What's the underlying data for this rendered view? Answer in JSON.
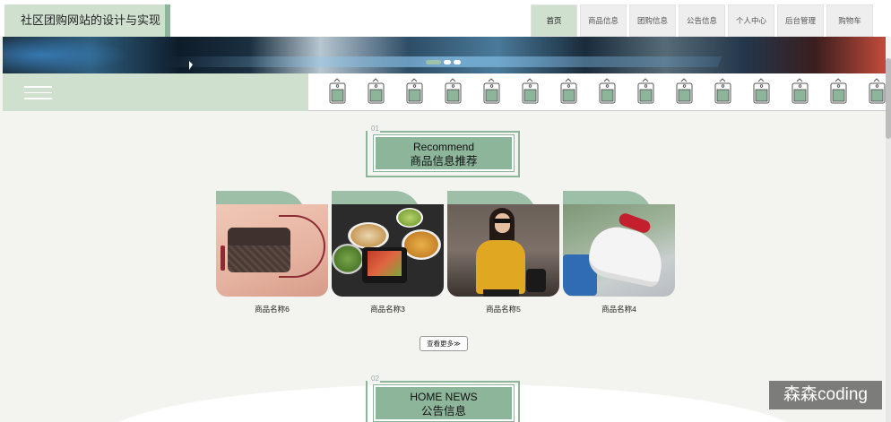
{
  "header": {
    "site_title": "社区团购网站的设计与实现",
    "nav": [
      "首页",
      "商品信息",
      "团购信息",
      "公告信息",
      "个人中心",
      "后台管理",
      "购物车"
    ],
    "active_nav": "首页"
  },
  "banner": {
    "slide_count": 3,
    "active_slide": 1
  },
  "category_strip": {
    "tag_icon": "price-tag-icon",
    "tag_count": 15
  },
  "recommend": {
    "number": "01",
    "title_en": "Recommend",
    "title_cn": "商品信息推荐",
    "products": [
      {
        "name": "商品名称6"
      },
      {
        "name": "商品名称3"
      },
      {
        "name": "商品名称5"
      },
      {
        "name": "商品名称4"
      }
    ],
    "more_label": "查看更多≫"
  },
  "news": {
    "number": "02",
    "title_en": "HOME NEWS",
    "title_cn": "公告信息"
  },
  "watermark": "森森coding",
  "colors": {
    "accent": "#8db59a",
    "accent_light": "#cfe0cf",
    "page_bg": "#f3f4ef"
  }
}
